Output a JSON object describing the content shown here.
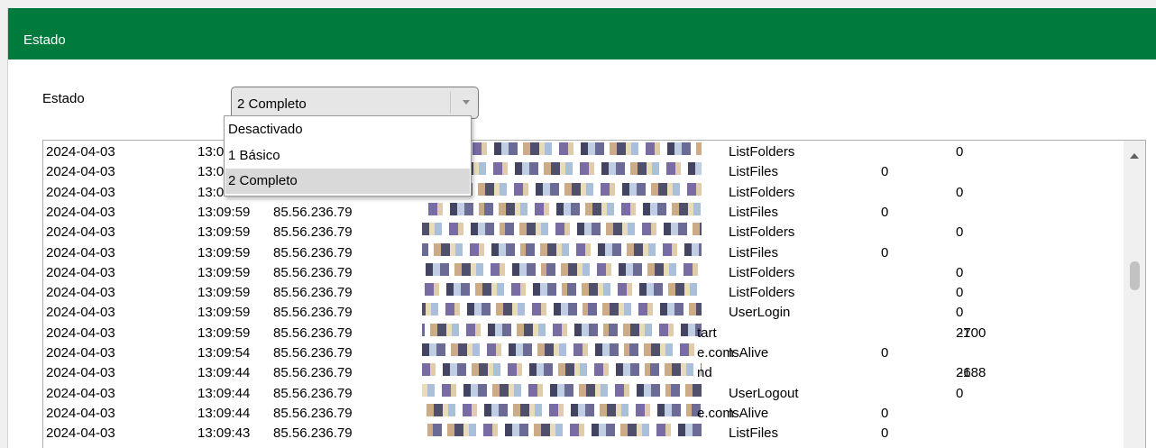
{
  "panel": {
    "title": "Estado"
  },
  "state_field": {
    "label": "Estado",
    "selected": "2 Completo",
    "options": [
      "Desactivado",
      "1 Básico",
      "2 Completo"
    ]
  },
  "log": {
    "rows": [
      {
        "date": "2024-04-03",
        "time": "13:0",
        "ip": "",
        "suffix": "",
        "op": "ListFolders",
        "a": "",
        "neg": "",
        "b": "0"
      },
      {
        "date": "2024-04-03",
        "time": "13:0",
        "ip": "",
        "suffix": "",
        "op": "ListFiles",
        "a": "0",
        "neg": "",
        "b": ""
      },
      {
        "date": "2024-04-03",
        "time": "13:0",
        "ip": "",
        "suffix": "",
        "op": "ListFolders",
        "a": "",
        "neg": "",
        "b": "0"
      },
      {
        "date": "2024-04-03",
        "time": "13:09:59",
        "ip": "85.56.236.79",
        "suffix": "",
        "op": "ListFiles",
        "a": "0",
        "neg": "",
        "b": ""
      },
      {
        "date": "2024-04-03",
        "time": "13:09:59",
        "ip": "85.56.236.79",
        "suffix": "",
        "op": "ListFolders",
        "a": "",
        "neg": "",
        "b": "0"
      },
      {
        "date": "2024-04-03",
        "time": "13:09:59",
        "ip": "85.56.236.79",
        "suffix": "",
        "op": "ListFiles",
        "a": "0",
        "neg": "",
        "b": ""
      },
      {
        "date": "2024-04-03",
        "time": "13:09:59",
        "ip": "85.56.236.79",
        "suffix": "",
        "op": "ListFolders",
        "a": "",
        "neg": "",
        "b": "0"
      },
      {
        "date": "2024-04-03",
        "time": "13:09:59",
        "ip": "85.56.236.79",
        "suffix": "",
        "op": "ListFolders",
        "a": "",
        "neg": "",
        "b": "0"
      },
      {
        "date": "2024-04-03",
        "time": "13:09:59",
        "ip": "85.56.236.79",
        "suffix": "",
        "op": "UserLogin",
        "a": "",
        "neg": "",
        "b": "0"
      },
      {
        "date": "2024-04-03",
        "time": "13:09:59",
        "ip": "85.56.236.79",
        "suffix": "tart",
        "op": "",
        "a": "",
        "neg": "-1",
        "b": "2700"
      },
      {
        "date": "2024-04-03",
        "time": "13:09:54",
        "ip": "85.56.236.79",
        "suffix": "e.com",
        "op": "IsAlive",
        "a": "0",
        "neg": "",
        "b": ""
      },
      {
        "date": "2024-04-03",
        "time": "13:09:44",
        "ip": "85.56.236.79",
        "suffix": "nd",
        "op": "",
        "a": "",
        "neg": "-1",
        "b": "2688"
      },
      {
        "date": "2024-04-03",
        "time": "13:09:44",
        "ip": "85.56.236.79",
        "suffix": "",
        "op": "UserLogout",
        "a": "",
        "neg": "",
        "b": "0"
      },
      {
        "date": "2024-04-03",
        "time": "13:09:44",
        "ip": "85.56.236.79",
        "suffix": "e.com",
        "op": "IsAlive",
        "a": "0",
        "neg": "",
        "b": ""
      },
      {
        "date": "2024-04-03",
        "time": "13:09:43",
        "ip": "85.56.236.79",
        "suffix": "",
        "op": "ListFiles",
        "a": "0",
        "neg": "",
        "b": ""
      }
    ]
  },
  "colors": {
    "header": "#007a3d",
    "selected_option": "#d9d9d9"
  },
  "icons": {
    "combo": "chevron-down-icon",
    "scroll": "scroll-up-arrow-icon"
  }
}
